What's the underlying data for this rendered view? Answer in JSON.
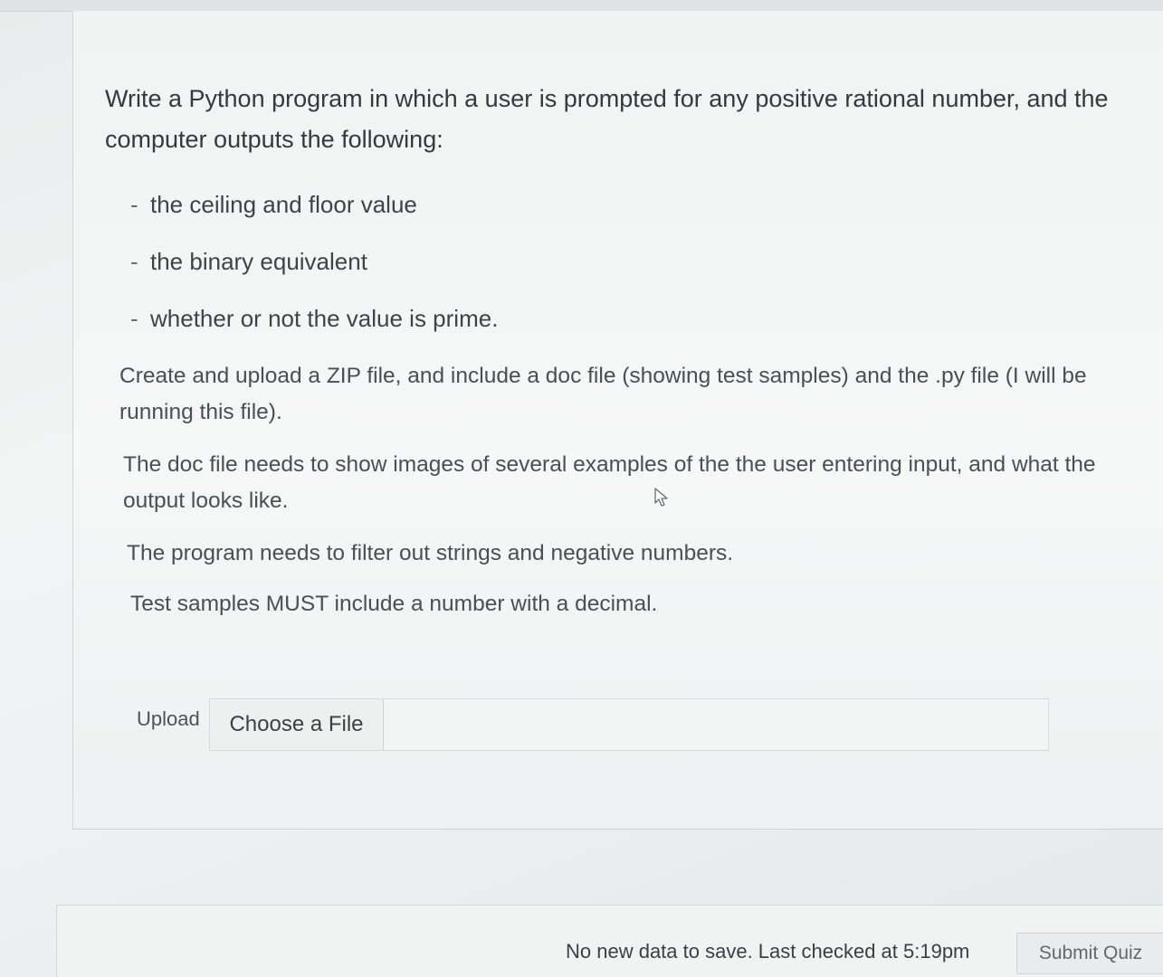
{
  "question": {
    "intro": "Write a Python program in which a user is prompted for any positive rational number, and the computer outputs the following:",
    "bullets": [
      "the ceiling and floor value",
      "the binary equivalent",
      "whether or not the value is prime."
    ],
    "bullet_marker": "-",
    "paragraphs": [
      "Create and upload a ZIP file, and include a doc file (showing test samples) and the .py file (I will be running this file).",
      "The doc file needs to show images of several examples of the the user entering input, and what the output looks like.",
      "The program needs to filter out strings and negative numbers.",
      "Test samples MUST include a number with a decimal."
    ]
  },
  "upload": {
    "label": "Upload",
    "choose_file_label": "Choose a File"
  },
  "footer": {
    "save_status": "No new data to save. Last checked at 5:19pm",
    "submit_label": "Submit Quiz"
  },
  "icons": {
    "cursor": "mouse-pointer-icon"
  },
  "colors": {
    "text": "#35393c",
    "muted_text": "#4a4f53",
    "panel_bg": "#f3f5f5",
    "border": "#d3d7d9"
  }
}
